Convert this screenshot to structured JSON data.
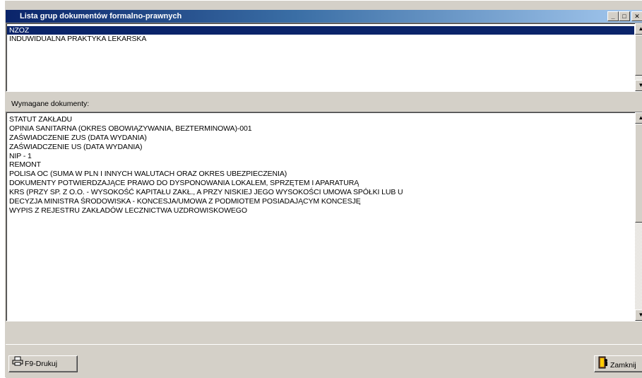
{
  "window": {
    "title": "Lista grup dokumentów formalno-prawnych",
    "controls": {
      "minimize": "_",
      "maximize": "□",
      "close": "✕"
    }
  },
  "groups": {
    "items": [
      {
        "label": "NZOZ",
        "selected": true
      },
      {
        "label": "INDUWIDUALNA PRAKTYKA LEKARSKA",
        "selected": false
      }
    ]
  },
  "docs": {
    "label": "Wymagane dokumenty:",
    "items": [
      "STATUT ZAKŁADU",
      "OPINIA SANITARNA (OKRES OBOWIĄZYWANIA, BEZTERMINOWA)-001",
      "ZAŚWIADCZENIE ZUS  (DATA WYDANIA)",
      "ZAŚWIADCZENIE US  (DATA WYDANIA)",
      "NIP - 1",
      "REMONT",
      "POLISA OC  (SUMA W PLN I INNYCH WALUTACH ORAZ OKRES UBEZPIECZENIA)",
      "DOKUMENTY POTWIERDZAJĄCE PRAWO DO DYSPONOWANIA LOKALEM, SPRZĘTEM I APARATURĄ",
      "KRS (PRZY SP. Z O.O. - WYSOKOŚĆ KAPITAŁU ZAKŁ., A PRZY NISKIEJ JEGO WYSOKOŚCI UMOWA SPÓŁKI LUB U",
      "DECYZJA MINISTRA ŚRODOWISKA - KONCESJA/UMOWA Z PODMIOTEM POSIADAJĄCYM KONCESJĘ",
      "WYPIS Z REJESTRU ZAKŁADÓW LECZNICTWA UZDROWISKOWEGO"
    ]
  },
  "buttons": {
    "print": "F9-Drukuj",
    "close": "Zamknij"
  },
  "icons": {
    "print": "printer-icon",
    "close": "door-exit-icon"
  },
  "colors": {
    "selection": "#0a246a",
    "face": "#d4d0c8",
    "title_start": "#0a246a",
    "title_end": "#a6caf0"
  }
}
